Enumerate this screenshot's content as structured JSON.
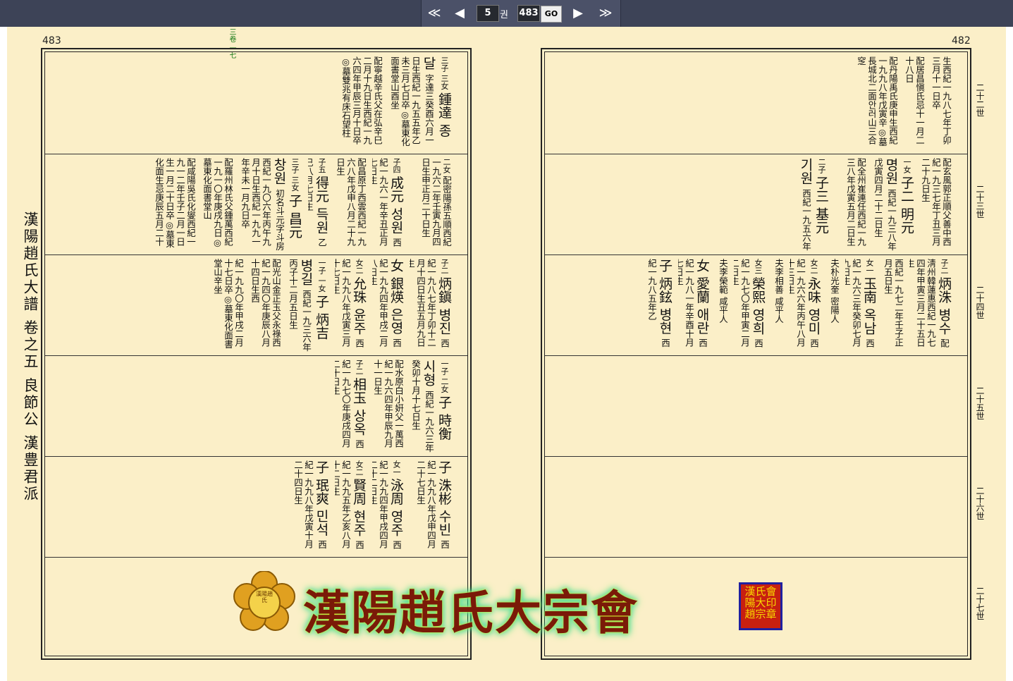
{
  "nav": {
    "first": "≪",
    "prev": "◀",
    "vol_value": "5",
    "vol_unit": "권",
    "page_value": "483",
    "go": "GO",
    "next": "▶",
    "last": "≫"
  },
  "pages": {
    "left": "483",
    "right": "482"
  },
  "title": "漢陽趙氏大譜 卷之五 良節公 漢豊君派",
  "top_mark": "三卷 一七",
  "generations": [
    "二十二世",
    "二十三世",
    "二十四世",
    "二十五世",
    "二十六世",
    "二十七世"
  ],
  "left": [
    {
      "row": "r1",
      "entries": [
        {
          "rel": "三子 三女",
          "name": "鍾達 종달",
          "text": "字達三癸酉六月一日生西紀一九五五年乙未三月七日卒◎墓東化面書堂山酉坐"
        },
        {
          "rel": "",
          "name": "",
          "text": "配寧越辛氏父在弘辛巳二月十九日生西紀一九六四年甲辰三月十日卒◎墓雙兆有床石望柱"
        }
      ]
    },
    {
      "row": "r2",
      "entries": [
        {
          "rel": "二女",
          "name": "",
          "text": "配密陽孫五順西紀一九六二年壬寅九月四日生申正月二十日生"
        },
        {
          "rel": "子四",
          "name": "成元 성원",
          "text": "西紀一九六一年辛丑正月七日生"
        },
        {
          "rel": "",
          "name": "",
          "text": "配昌原丁西雲西紀一九六八年戊申八月二十九日生"
        },
        {
          "rel": "子五",
          "name": "得元 득원",
          "text": "乙巳八月七日生"
        },
        {
          "rel": "三子 三女",
          "name": "子 昌元 창원",
          "text": "初名斗元字斗房西紀一九〇六年丙午九月十日生西紀一九九一年辛未一月九日卒"
        },
        {
          "rel": "",
          "name": "",
          "text": "配羅州林氏父鍾萬西紀一九一〇年庚戌九日◎墓東化面書堂山"
        },
        {
          "rel": "",
          "name": "",
          "text": "配咸陽吳氏化燮西紀一九一二年壬子二月一日生一月二十日卒◎墓東化面生忌庚辰五月二十"
        }
      ]
    },
    {
      "row": "r3",
      "entries": [
        {
          "rel": "子二",
          "name": "炳鎭 병진",
          "text": "西紀一九八七年丁卯十二月十四日生丑五月九日生"
        },
        {
          "rel": "",
          "name": "女 銀煐 은영",
          "text": "西紀一九九四年甲戌二月八日生"
        },
        {
          "rel": "女二",
          "name": "允珠 윤주",
          "text": "西紀一九九八年戊寅三月十七日生"
        },
        {
          "rel": "一子 一女",
          "name": "子 炳吉 병길",
          "text": "西紀一九三六年丙子十二月五日生"
        },
        {
          "rel": "",
          "name": "",
          "text": "配光山金正玉父永祿西紀一九四〇年庚辰八月十四日生西"
        },
        {
          "rel": "",
          "name": "",
          "text": "紀一九九〇年甲戌二月十七日卒◎墓東化面書堂山辛坐"
        }
      ]
    },
    {
      "row": "r4",
      "entries": [
        {
          "rel": "一子 二女",
          "name": "子 時衡 시형",
          "text": "西紀一九六三年癸卯十月十七日生"
        },
        {
          "rel": "",
          "name": "",
          "text": "配水原白小姸父一萬西紀一九六四年甲辰九月十一日生"
        },
        {
          "rel": "子二",
          "name": "相玉 상옥",
          "text": "西紀一九七〇年庚戌四月二十日生"
        }
      ]
    },
    {
      "row": "r5",
      "entries": [
        {
          "rel": "",
          "name": "子 洙彬 수빈",
          "text": "西紀一九九八年戊申四月二十七日生"
        },
        {
          "rel": "女一",
          "name": "泳周 영주",
          "text": "西紀一九九四年甲戌四月二十二日生"
        },
        {
          "rel": "女二",
          "name": "賢周 현주",
          "text": "西紀一九九五年乙亥八月十二日生"
        },
        {
          "rel": "",
          "name": "子 珉爽 민석",
          "text": "西紀一九九八年戊寅十月二十四日生"
        }
      ]
    }
  ],
  "right": [
    {
      "row": "r1",
      "entries": [
        {
          "rel": "",
          "name": "",
          "text": "生西紀一九八七年丁卯三月十一日卒"
        },
        {
          "rel": "",
          "name": "",
          "text": "配居昌愼氏忌十一月二十八日"
        },
        {
          "rel": "",
          "name": "",
          "text": "配丹陽禹氏庚申生西紀一九九八年戊寅辛◎墓長城北二面안러山三合窆"
        }
      ]
    },
    {
      "row": "r2",
      "entries": [
        {
          "rel": "",
          "name": "",
          "text": "配玄風郭正順父善中西紀一九三七年丁丑三月二十九日生"
        },
        {
          "rel": "一女",
          "name": "子二 明元 명원",
          "text": "西紀一九三八年戊寅四月二十二日生"
        },
        {
          "rel": "",
          "name": "",
          "text": "配全州崔連任西紀一九三八年戊寅五月二日生"
        },
        {
          "rel": "二子",
          "name": "子三 基元 기원",
          "text": "西紀一九五六年丙"
        }
      ]
    },
    {
      "row": "r3",
      "entries": [
        {
          "rel": "子二",
          "name": "炳洙 병수",
          "text": "配淸州韓蓮惠西紀一九七四年甲寅三月二十五日生"
        },
        {
          "rel": "",
          "name": "",
          "text": "西紀一九七二年壬子正月五日生"
        },
        {
          "rel": "女一",
          "name": "玉南 옥남",
          "text": "西紀一九六三年癸卯七月九日生"
        },
        {
          "rel": "",
          "name": "",
          "text": "夫朴光奎 密陽人"
        },
        {
          "rel": "女二",
          "name": "永味 영미",
          "text": "西紀一九六六年丙午八月十三日生"
        },
        {
          "rel": "",
          "name": "",
          "text": "夫李相善 咸平人"
        },
        {
          "rel": "女三",
          "name": "榮熙 영희",
          "text": "西紀一九七〇年甲寅二月二日生"
        },
        {
          "rel": "",
          "name": "",
          "text": "夫李榮範 咸平人"
        },
        {
          "rel": "",
          "name": "女 愛蘭 애란",
          "text": "西紀一九八一年辛酉十月七日生"
        },
        {
          "rel": "",
          "name": "子 炳鉉 병현",
          "text": "西紀一九八五年乙"
        }
      ]
    }
  ],
  "logo": {
    "text": "漢陽趙氏大宗會",
    "seal": [
      "漢氏會",
      "陽大印",
      "趙宗章"
    ],
    "emblem": "漢陽趙氏"
  }
}
